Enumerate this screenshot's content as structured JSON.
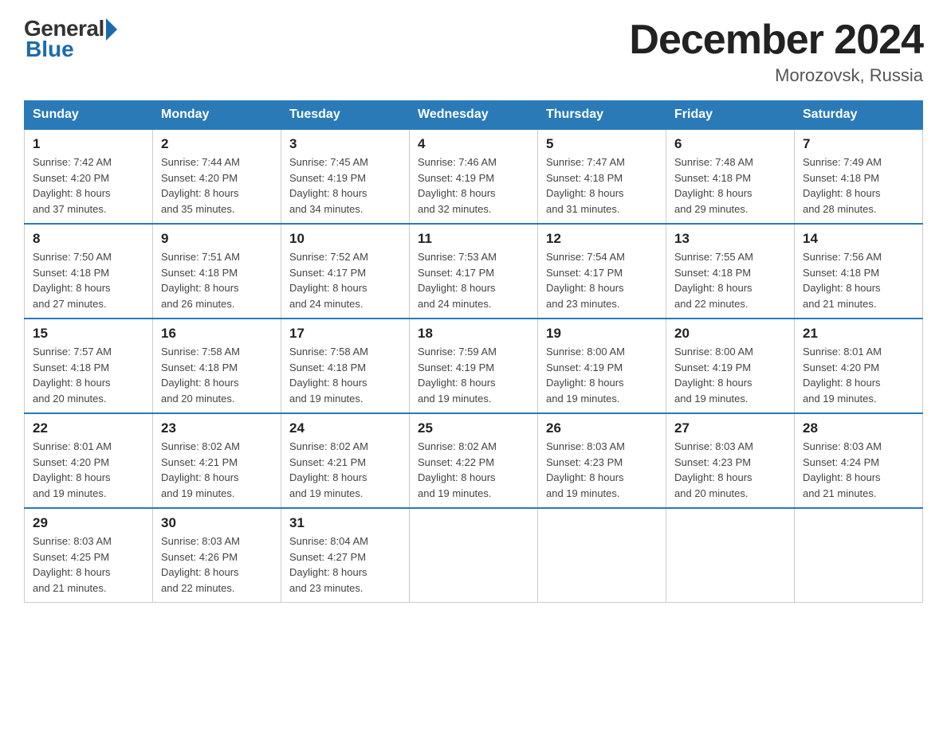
{
  "header": {
    "logo_general": "General",
    "logo_blue": "Blue",
    "month_title": "December 2024",
    "location": "Morozovsk, Russia"
  },
  "days_of_week": [
    "Sunday",
    "Monday",
    "Tuesday",
    "Wednesday",
    "Thursday",
    "Friday",
    "Saturday"
  ],
  "weeks": [
    [
      {
        "day": "1",
        "sunrise": "7:42 AM",
        "sunset": "4:20 PM",
        "daylight": "8 hours and 37 minutes."
      },
      {
        "day": "2",
        "sunrise": "7:44 AM",
        "sunset": "4:20 PM",
        "daylight": "8 hours and 35 minutes."
      },
      {
        "day": "3",
        "sunrise": "7:45 AM",
        "sunset": "4:19 PM",
        "daylight": "8 hours and 34 minutes."
      },
      {
        "day": "4",
        "sunrise": "7:46 AM",
        "sunset": "4:19 PM",
        "daylight": "8 hours and 32 minutes."
      },
      {
        "day": "5",
        "sunrise": "7:47 AM",
        "sunset": "4:18 PM",
        "daylight": "8 hours and 31 minutes."
      },
      {
        "day": "6",
        "sunrise": "7:48 AM",
        "sunset": "4:18 PM",
        "daylight": "8 hours and 29 minutes."
      },
      {
        "day": "7",
        "sunrise": "7:49 AM",
        "sunset": "4:18 PM",
        "daylight": "8 hours and 28 minutes."
      }
    ],
    [
      {
        "day": "8",
        "sunrise": "7:50 AM",
        "sunset": "4:18 PM",
        "daylight": "8 hours and 27 minutes."
      },
      {
        "day": "9",
        "sunrise": "7:51 AM",
        "sunset": "4:18 PM",
        "daylight": "8 hours and 26 minutes."
      },
      {
        "day": "10",
        "sunrise": "7:52 AM",
        "sunset": "4:17 PM",
        "daylight": "8 hours and 24 minutes."
      },
      {
        "day": "11",
        "sunrise": "7:53 AM",
        "sunset": "4:17 PM",
        "daylight": "8 hours and 24 minutes."
      },
      {
        "day": "12",
        "sunrise": "7:54 AM",
        "sunset": "4:17 PM",
        "daylight": "8 hours and 23 minutes."
      },
      {
        "day": "13",
        "sunrise": "7:55 AM",
        "sunset": "4:18 PM",
        "daylight": "8 hours and 22 minutes."
      },
      {
        "day": "14",
        "sunrise": "7:56 AM",
        "sunset": "4:18 PM",
        "daylight": "8 hours and 21 minutes."
      }
    ],
    [
      {
        "day": "15",
        "sunrise": "7:57 AM",
        "sunset": "4:18 PM",
        "daylight": "8 hours and 20 minutes."
      },
      {
        "day": "16",
        "sunrise": "7:58 AM",
        "sunset": "4:18 PM",
        "daylight": "8 hours and 20 minutes."
      },
      {
        "day": "17",
        "sunrise": "7:58 AM",
        "sunset": "4:18 PM",
        "daylight": "8 hours and 19 minutes."
      },
      {
        "day": "18",
        "sunrise": "7:59 AM",
        "sunset": "4:19 PM",
        "daylight": "8 hours and 19 minutes."
      },
      {
        "day": "19",
        "sunrise": "8:00 AM",
        "sunset": "4:19 PM",
        "daylight": "8 hours and 19 minutes."
      },
      {
        "day": "20",
        "sunrise": "8:00 AM",
        "sunset": "4:19 PM",
        "daylight": "8 hours and 19 minutes."
      },
      {
        "day": "21",
        "sunrise": "8:01 AM",
        "sunset": "4:20 PM",
        "daylight": "8 hours and 19 minutes."
      }
    ],
    [
      {
        "day": "22",
        "sunrise": "8:01 AM",
        "sunset": "4:20 PM",
        "daylight": "8 hours and 19 minutes."
      },
      {
        "day": "23",
        "sunrise": "8:02 AM",
        "sunset": "4:21 PM",
        "daylight": "8 hours and 19 minutes."
      },
      {
        "day": "24",
        "sunrise": "8:02 AM",
        "sunset": "4:21 PM",
        "daylight": "8 hours and 19 minutes."
      },
      {
        "day": "25",
        "sunrise": "8:02 AM",
        "sunset": "4:22 PM",
        "daylight": "8 hours and 19 minutes."
      },
      {
        "day": "26",
        "sunrise": "8:03 AM",
        "sunset": "4:23 PM",
        "daylight": "8 hours and 19 minutes."
      },
      {
        "day": "27",
        "sunrise": "8:03 AM",
        "sunset": "4:23 PM",
        "daylight": "8 hours and 20 minutes."
      },
      {
        "day": "28",
        "sunrise": "8:03 AM",
        "sunset": "4:24 PM",
        "daylight": "8 hours and 21 minutes."
      }
    ],
    [
      {
        "day": "29",
        "sunrise": "8:03 AM",
        "sunset": "4:25 PM",
        "daylight": "8 hours and 21 minutes."
      },
      {
        "day": "30",
        "sunrise": "8:03 AM",
        "sunset": "4:26 PM",
        "daylight": "8 hours and 22 minutes."
      },
      {
        "day": "31",
        "sunrise": "8:04 AM",
        "sunset": "4:27 PM",
        "daylight": "8 hours and 23 minutes."
      },
      null,
      null,
      null,
      null
    ]
  ],
  "labels": {
    "sunrise": "Sunrise:",
    "sunset": "Sunset:",
    "daylight": "Daylight:"
  }
}
